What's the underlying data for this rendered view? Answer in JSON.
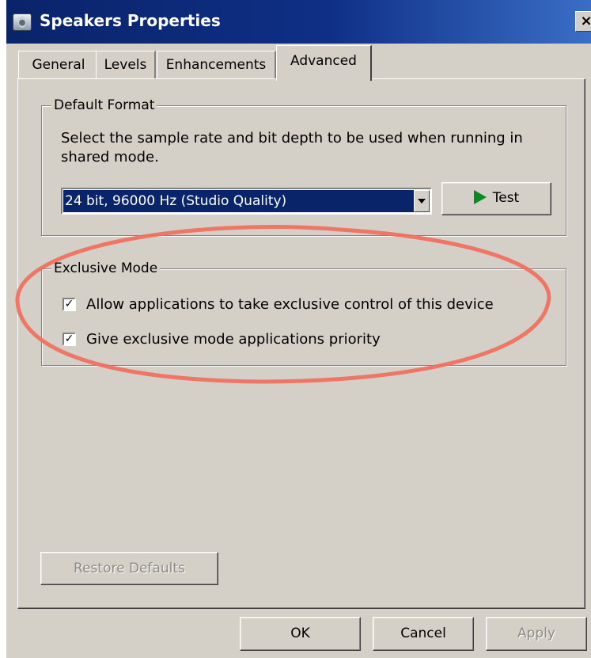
{
  "window": {
    "title": "Speakers Properties",
    "close_glyph": "×"
  },
  "tabs": [
    {
      "label": "General",
      "active": false
    },
    {
      "label": "Levels",
      "active": false
    },
    {
      "label": "Enhancements",
      "active": false
    },
    {
      "label": "Advanced",
      "active": true
    }
  ],
  "default_format": {
    "legend": "Default Format",
    "description": "Select the sample rate and bit depth to be used when running in shared mode.",
    "selected_format": "24 bit, 96000 Hz (Studio Quality)",
    "test_label": "Test"
  },
  "exclusive_mode": {
    "legend": "Exclusive Mode",
    "options": [
      {
        "label": "Allow applications to take exclusive control of this device",
        "checked": true,
        "check_glyph": "✓"
      },
      {
        "label": "Give exclusive mode applications priority",
        "checked": true,
        "check_glyph": "✓"
      }
    ]
  },
  "restore_defaults_label": "Restore Defaults",
  "footer": {
    "ok_label": "OK",
    "cancel_label": "Cancel",
    "apply_label": "Apply"
  },
  "colors": {
    "title_bar": "#0a246a",
    "dialog_face": "#d4d0c8",
    "selection": "#0a246a",
    "test_icon": "#0a8a24",
    "annotation": "#f26b5b"
  }
}
